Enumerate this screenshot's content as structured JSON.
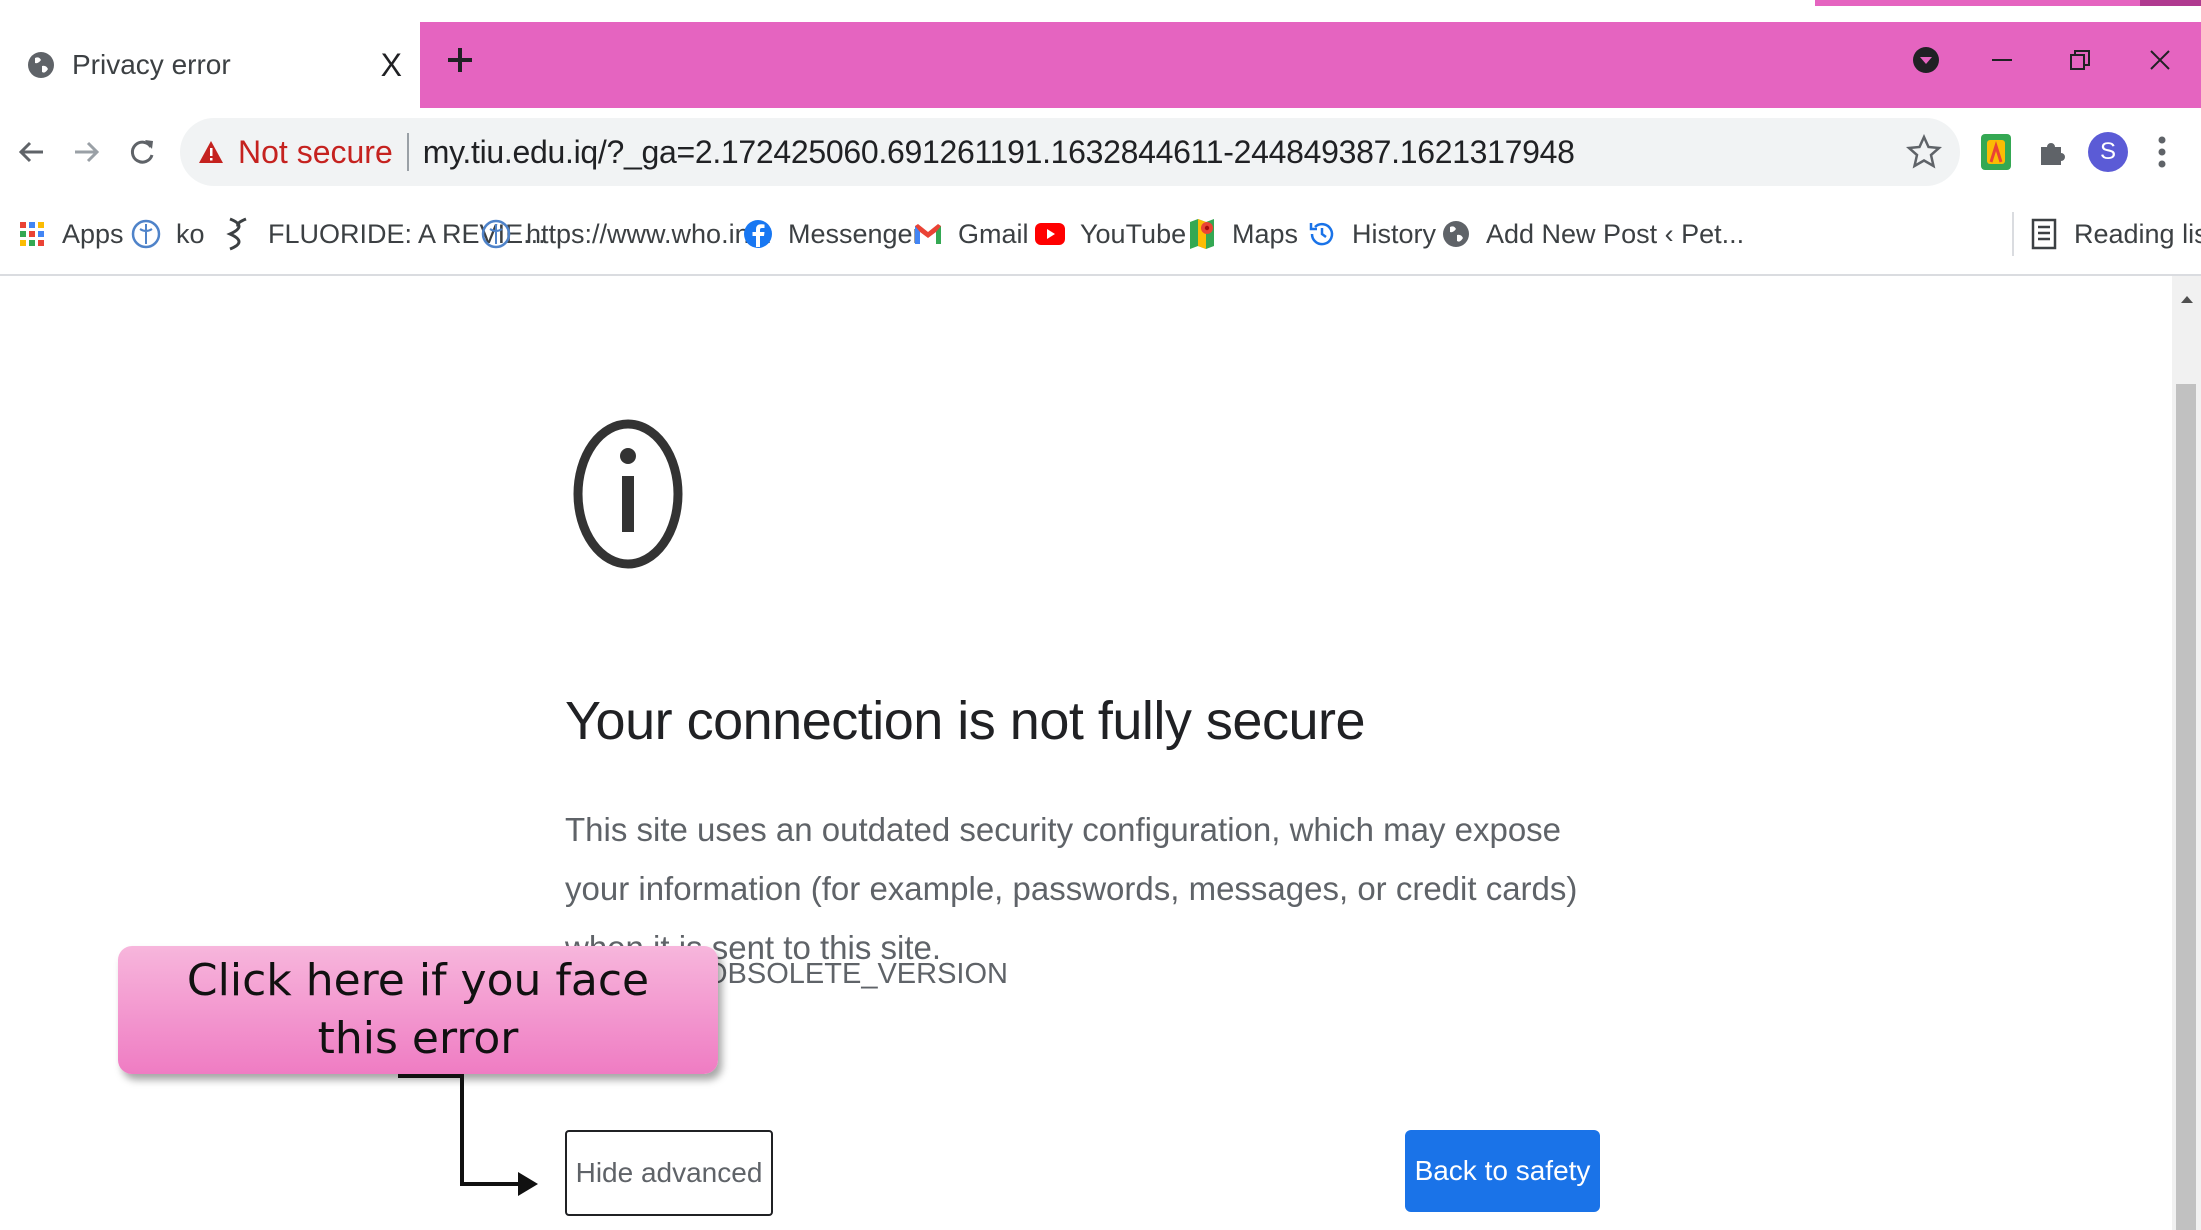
{
  "tab": {
    "title": "Privacy error",
    "close_label": "X"
  },
  "window": {
    "accent_color": "#e564c0"
  },
  "address_bar": {
    "security_label": "Not secure",
    "url": "my.tiu.edu.iq/?_ga=2.172425060.691261191.1632844611-244849387.1621317948"
  },
  "profile": {
    "initial": "S"
  },
  "bookmarks": [
    {
      "label": "Apps",
      "icon": "apps-grid-icon"
    },
    {
      "label": "ko",
      "icon": "who-globe-icon"
    },
    {
      "label": "FLUORIDE: A REVIE...",
      "icon": "dna-icon"
    },
    {
      "label": "https://www.who.in...",
      "icon": "who-globe-icon"
    },
    {
      "label": "Messenger",
      "icon": "facebook-icon"
    },
    {
      "label": "Gmail",
      "icon": "gmail-icon"
    },
    {
      "label": "YouTube",
      "icon": "youtube-icon"
    },
    {
      "label": "Maps",
      "icon": "maps-icon"
    },
    {
      "label": "History",
      "icon": "history-icon"
    },
    {
      "label": "Add New Post ‹ Pet...",
      "icon": "globe-icon"
    }
  ],
  "reading_list": {
    "label": "Reading list"
  },
  "error_page": {
    "heading": "Your connection is not fully secure",
    "body": "This site uses an outdated security configuration, which may expose your information (for example, passwords, messages, or credit cards) when it is sent to this site.",
    "error_code_visible": "OBSOLETE_VERSION",
    "hide_advanced_label": "Hide advanced",
    "back_to_safety_label": "Back to safety",
    "primary_color": "#1a73e8"
  },
  "callout": {
    "text": "Click here if you face this error"
  }
}
